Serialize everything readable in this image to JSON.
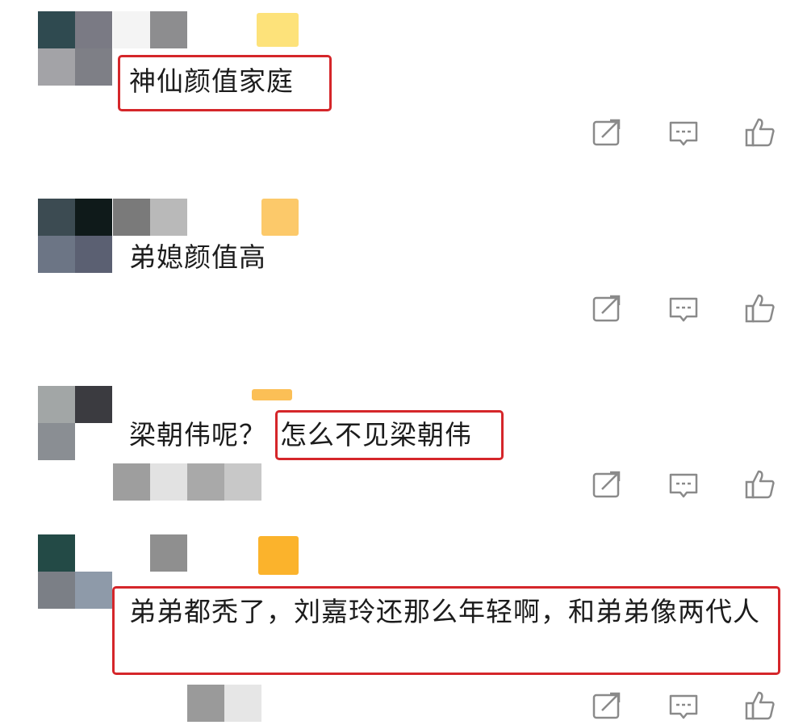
{
  "comments": [
    {
      "text": "神仙颜值家庭",
      "highlight_part": "",
      "mosaic_colors": [
        "#2f4a50",
        "#7a7a84",
        "#a3a3a7",
        "#7e7f86"
      ],
      "name_colors": [
        "#f4f4f4",
        "#8d8d8f"
      ],
      "badge_color": "#fde27a"
    },
    {
      "text": "弟媳颜值高",
      "highlight_part": "",
      "mosaic_colors": [
        "#3c4b52",
        "#0f1a1a",
        "#6c7585",
        "#5b6072"
      ],
      "name_colors": [
        "#7a7a7a",
        "#b9b9b9"
      ],
      "badge_color": "#fcc96a"
    },
    {
      "text": "梁朝伟呢？",
      "highlight_part": "怎么不见梁朝伟",
      "mosaic_colors": [
        "#a2a6a6",
        "#3b3b40",
        "#8a8e93",
        "#ffffff"
      ],
      "name_colors": [
        "#9e9e9e",
        "#e2e2e2",
        "#a9a9a9",
        "#c8c8c8"
      ],
      "badge_color": "#fbbf56"
    },
    {
      "text": "弟弟都秃了，刘嘉玲还那么年轻啊，和弟弟像两代人",
      "highlight_part": "",
      "mosaic_colors": [
        "#234a46",
        "#ffffff",
        "#7b7f86",
        "#8e9aa9"
      ],
      "name_colors": [
        "#8f8f8f",
        "#ffffff"
      ],
      "badge_color": "#fbb32c"
    }
  ],
  "icons": {
    "share": "share-icon",
    "reply": "comment-icon",
    "like": "thumbs-up-icon"
  },
  "colors": {
    "highlight_border": "#d5262a",
    "icon_stroke": "#8a8a8a"
  }
}
